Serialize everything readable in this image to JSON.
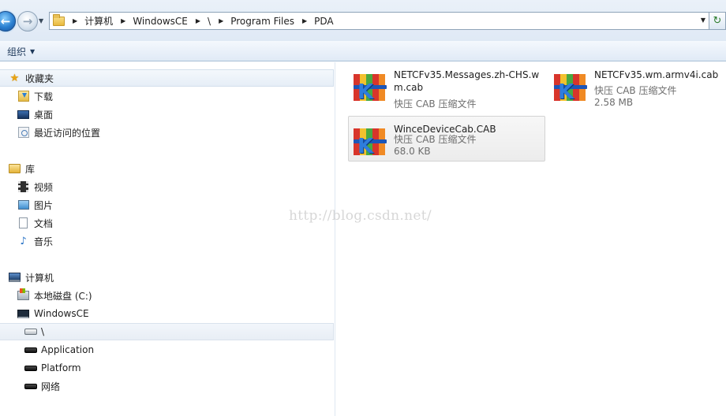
{
  "address_bar": {
    "crumbs": [
      "计算机",
      "WindowsCE",
      "\\",
      "Program Files",
      "PDA"
    ]
  },
  "toolbar": {
    "organize_label": "组织"
  },
  "nav": {
    "favorites": {
      "label": "收藏夹",
      "items": [
        "下载",
        "桌面",
        "最近访问的位置"
      ]
    },
    "libraries": {
      "label": "库",
      "items": [
        "视频",
        "图片",
        "文档",
        "音乐"
      ]
    },
    "computer": {
      "label": "计算机",
      "items": [
        "本地磁盘 (C:)",
        "WindowsCE"
      ]
    },
    "device_items": [
      "\\",
      "Application",
      "Platform",
      "网络"
    ]
  },
  "files": [
    {
      "name": "NETCFv35.Messages.zh-CHS.wm.cab",
      "type": "快压 CAB 压缩文件",
      "size": ""
    },
    {
      "name": "NETCFv35.wm.armv4i.cab",
      "type": "快压 CAB 压缩文件",
      "size": "2.58 MB"
    },
    {
      "name": "WinceDeviceCab.CAB",
      "type": "快压 CAB 压缩文件",
      "size": "68.0 KB"
    }
  ],
  "watermark": "http://blog.csdn.net/",
  "colors": {
    "accent": "#2a7fd0",
    "selection_bg": "#e6eef7",
    "muted_text": "#6d6d6d"
  },
  "icons": {
    "file": "cab-archive-icon",
    "nav_back": "back-arrow-icon",
    "nav_forward": "forward-arrow-icon"
  }
}
